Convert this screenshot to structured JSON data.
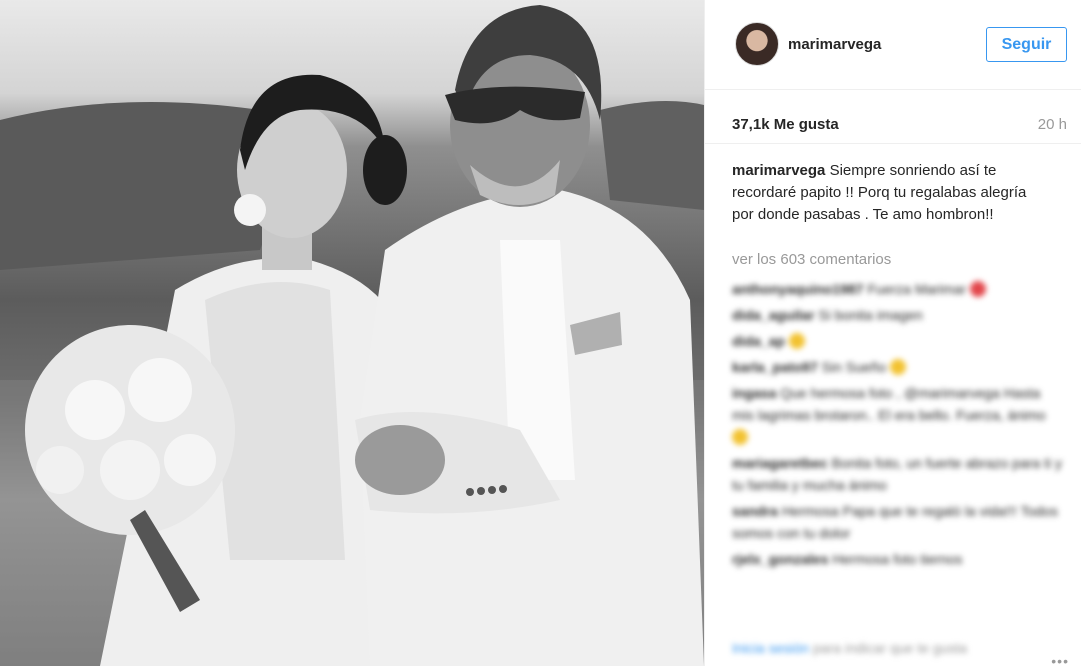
{
  "post": {
    "username": "marimarvega",
    "follow_label": "Seguir",
    "likes": "37,1k Me gusta",
    "time": "20 h",
    "caption_user": "marimarvega",
    "caption_text": "Siempre sonriendo así te recordaré papito !! Porq tu regalabas alegría por donde pasabas . Te amo hombron!!",
    "view_comments": "ver los 603 comentarios",
    "more_icon": "more-options-icon"
  },
  "comments": [
    {
      "user": "anthonyaquino1987",
      "text": "Fuerza Marimar"
    },
    {
      "user": "dida_aguilar",
      "text": "Si bonita imagen"
    },
    {
      "user": "dida_ap",
      "text": ""
    },
    {
      "user": "karla_pato97",
      "text": "Sin Sueño"
    },
    {
      "user": "ingasa",
      "text": "Que hermosa foto , @marimarvega Hasta mis lagrimas brotaron.. El era bello. Fuerza, ánimo"
    },
    {
      "user": "mariagaretbec",
      "text": "Bonita foto, un fuerte abrazo para ti y tu familia y mucha ánimo"
    },
    {
      "user": "sandra",
      "text": "Hermosa Papa que te regaló la vida!!! Todos somos con tu dolor"
    },
    {
      "user": "rjelx_gonzales",
      "text": "Hermosa foto tiernos"
    }
  ],
  "login_prompt": {
    "link": "Inicia sesión",
    "text": "para indicar que te gusta"
  },
  "colors": {
    "accent": "#3897f0",
    "muted": "#999999",
    "text": "#262626",
    "border": "#efefef"
  }
}
